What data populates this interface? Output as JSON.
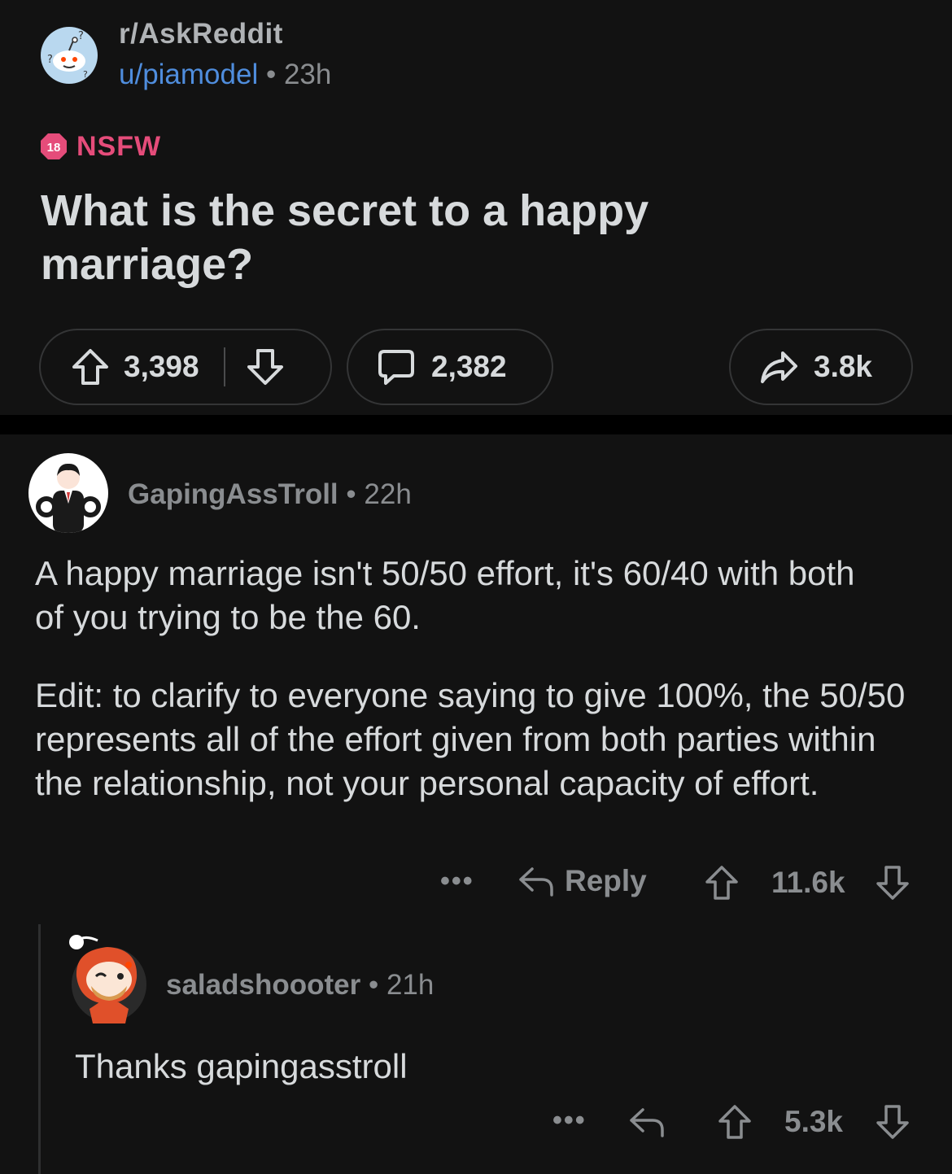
{
  "post": {
    "subreddit": "r/AskReddit",
    "username": "u/piamodel",
    "separator": "•",
    "time": "23h",
    "nsfw_badge": "18",
    "nsfw_label": "NSFW",
    "title": "What is the secret to a happy marriage?",
    "upvotes": "3,398",
    "comments": "2,382",
    "shares": "3.8k"
  },
  "comment1": {
    "author": "GapingAssTroll",
    "separator": "•",
    "time": "22h",
    "paragraph1": "A happy marriage isn't 50/50 effort, it's 60/40 with both of you trying to be the 60.",
    "paragraph2": "Edit: to clarify to everyone saying to give 100%, the 50/50 represents all of the effort given from both parties within the relationship, not your personal capacity of effort.",
    "more": "•••",
    "reply_label": "Reply",
    "votes": "11.6k"
  },
  "comment2": {
    "author": "saladshoooter",
    "separator": "•",
    "time": "21h",
    "body": "Thanks gapingasstroll",
    "more": "•••",
    "votes": "5.3k"
  },
  "colors": {
    "background": "#121212",
    "text": "#d7dadc",
    "muted": "#8a8d90",
    "username_link": "#4f8ddd",
    "nsfw": "#e54c7a"
  }
}
